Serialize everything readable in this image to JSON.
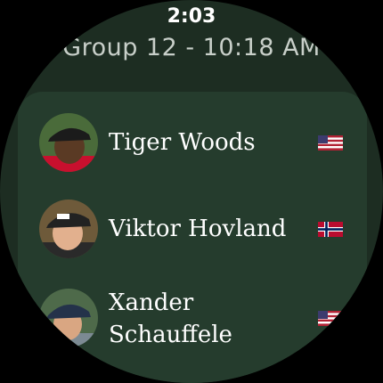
{
  "status_bar": {
    "time": "2:03"
  },
  "header": {
    "title": "Group 12 - 10:18 AM"
  },
  "players": [
    {
      "name_lines": [
        "Tiger Woods"
      ],
      "flag_icon": "usa-flag-icon",
      "shirt_color": "#c8102e",
      "cap_color": "#1b1b1b"
    },
    {
      "name_lines": [
        "Viktor Hovland"
      ],
      "flag_icon": "norway-flag-icon",
      "shirt_color": "#2a2a2a",
      "cap_color": "#222222"
    },
    {
      "name_lines": [
        "Xander",
        "Schauffele"
      ],
      "flag_icon": "usa-flag-icon",
      "shirt_color": "#7c8a93",
      "cap_color": "#24324a"
    }
  ],
  "colors": {
    "background": "#1d2d22",
    "card": "#253c2d",
    "text_primary": "#ffffff",
    "text_secondary": "#c8cfc9"
  }
}
